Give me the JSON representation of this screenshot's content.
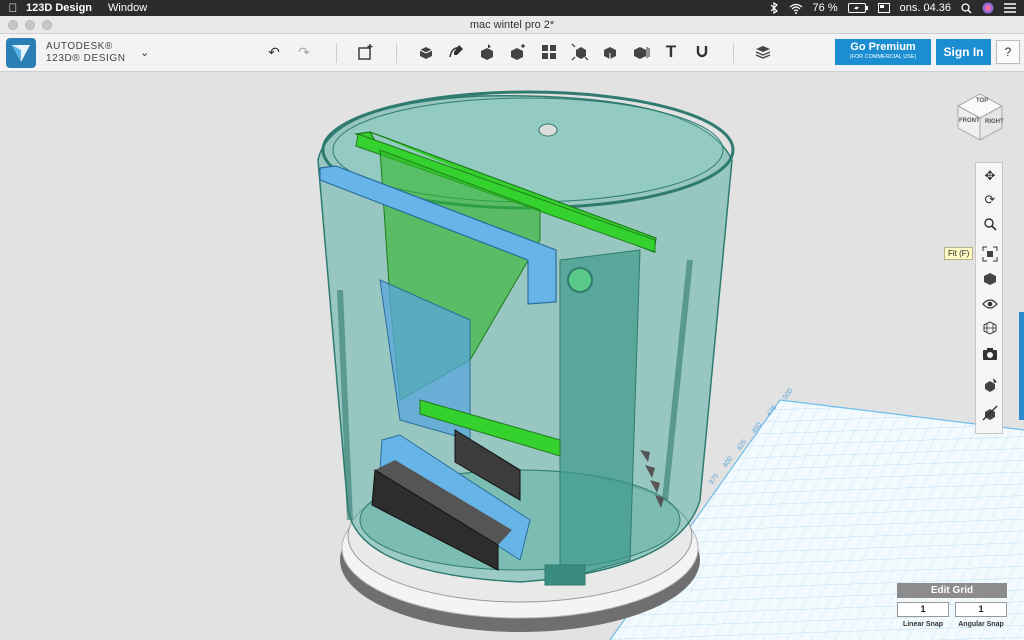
{
  "menubar": {
    "app_name": "123D Design",
    "menus": [
      "Window"
    ],
    "battery": "76 %",
    "clock": "ons. 04.36"
  },
  "window": {
    "title": "mac wintel pro 2*"
  },
  "brand": {
    "line1": "AUTODESK®",
    "line2": "123D® DESIGN"
  },
  "toolbar": {
    "premium_label": "Go Premium",
    "premium_sub": "(FOR COMMERCIAL USE)",
    "signin_label": "Sign In",
    "help_label": "?"
  },
  "viewcube": {
    "top": "TOP",
    "front": "FRONT",
    "right": "RIGHT"
  },
  "tooltip": {
    "text": "Fit (F)"
  },
  "grid_ruler": [
    "500",
    "475",
    "450",
    "425",
    "400",
    "375"
  ],
  "edit_grid": {
    "title": "Edit Grid",
    "linear_value": "1",
    "angular_value": "1",
    "linear_label": "Linear Snap",
    "angular_label": "Angular Snap"
  },
  "colors": {
    "accent": "#1a8ed1",
    "model_teal": "#3fa396",
    "board_green": "#35d12f",
    "board_blue": "#66b4e8",
    "grid": "#9fd4f3"
  }
}
